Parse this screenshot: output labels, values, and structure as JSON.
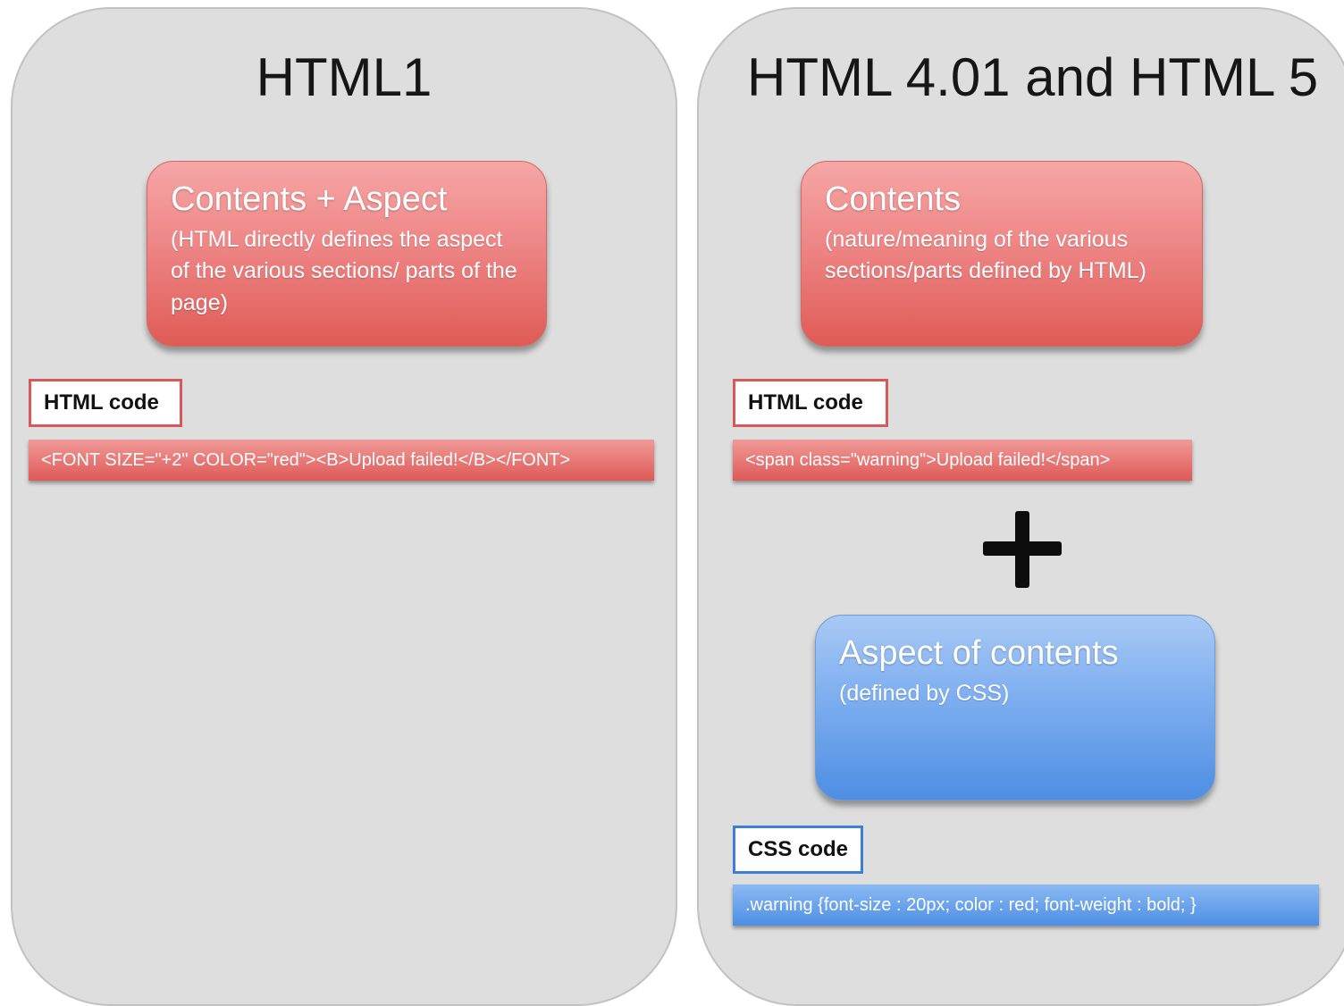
{
  "left_panel": {
    "title": "HTML1",
    "box": {
      "title": "Contents + Aspect",
      "subtitle": "(HTML directly defines the aspect of the various sections/ parts of the page)"
    },
    "code_label": "HTML code",
    "code": "<FONT SIZE=\"+2\" COLOR=\"red\"><B>Upload failed!</B></FONT>"
  },
  "right_panel": {
    "title": "HTML 4.01 and HTML 5",
    "contents_box": {
      "title": "Contents",
      "subtitle": "(nature/meaning of the various sections/parts defined by HTML)"
    },
    "html_code_label": "HTML code",
    "html_code": "<span class=\"warning\">Upload failed!</span>",
    "plus_icon": "plus-icon",
    "aspect_box": {
      "title": "Aspect of contents",
      "subtitle": "(defined by CSS)"
    },
    "css_code_label": "CSS code",
    "css_code": ".warning {font-size : 20px; color : red; font-weight : bold; }"
  },
  "colors": {
    "panel_bg": "#dedede",
    "red_box": "#e46a66",
    "blue_box": "#6aa1ea",
    "label_border_red": "#d9585a",
    "label_border_blue": "#3d7fd6"
  }
}
